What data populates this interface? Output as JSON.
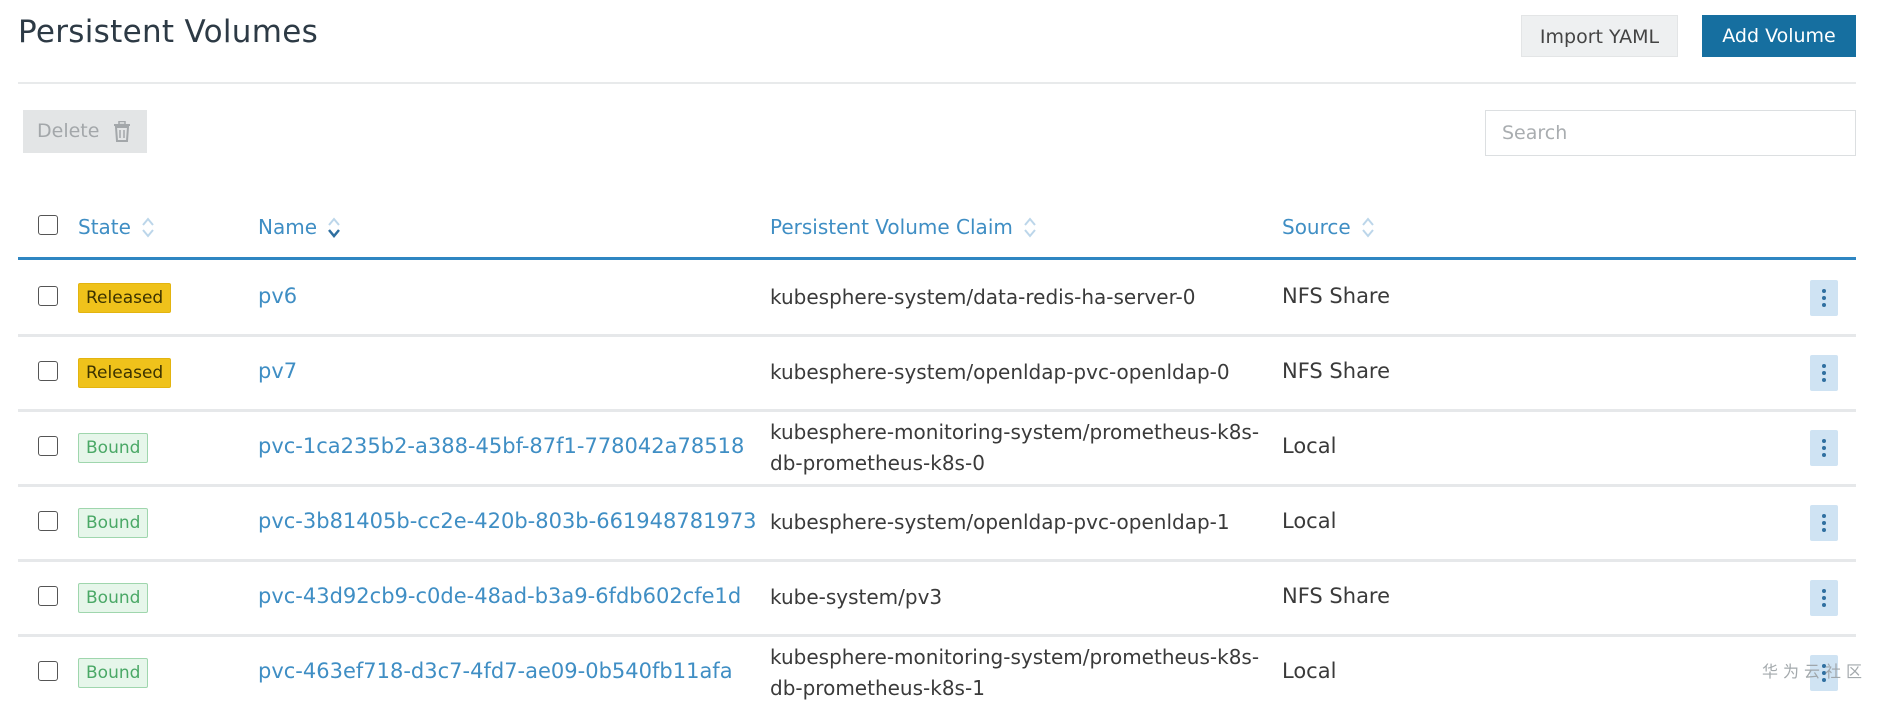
{
  "header": {
    "title": "Persistent Volumes",
    "import_label": "Import YAML",
    "add_label": "Add Volume"
  },
  "toolbar": {
    "delete_label": "Delete",
    "delete_icon": "trash-icon",
    "search_placeholder": "Search",
    "search_value": ""
  },
  "table": {
    "columns": [
      {
        "label": "State",
        "sort": "unsorted"
      },
      {
        "label": "Name",
        "sort": "descending"
      },
      {
        "label": "Persistent Volume Claim",
        "sort": "unsorted"
      },
      {
        "label": "Source",
        "sort": "unsorted"
      }
    ],
    "rows": [
      {
        "state": "Released",
        "name": "pv6",
        "pvc": "kubesphere-system/data-redis-ha-server-0",
        "source": "NFS Share"
      },
      {
        "state": "Released",
        "name": "pv7",
        "pvc": "kubesphere-system/openldap-pvc-openldap-0",
        "source": "NFS Share"
      },
      {
        "state": "Bound",
        "name": "pvc-1ca235b2-a388-45bf-87f1-778042a78518",
        "pvc": "kubesphere-monitoring-system/prometheus-k8s-db-prometheus-k8s-0",
        "source": "Local"
      },
      {
        "state": "Bound",
        "name": "pvc-3b81405b-cc2e-420b-803b-661948781973",
        "pvc": "kubesphere-system/openldap-pvc-openldap-1",
        "source": "Local"
      },
      {
        "state": "Bound",
        "name": "pvc-43d92cb9-c0de-48ad-b3a9-6fdb602cfe1d",
        "pvc": "kube-system/pv3",
        "source": "NFS Share"
      },
      {
        "state": "Bound",
        "name": "pvc-463ef718-d3c7-4fd7-ae09-0b540fb11afa",
        "pvc": "kubesphere-monitoring-system/prometheus-k8s-db-prometheus-k8s-1",
        "source": "Local"
      }
    ]
  },
  "watermark": "华为云社区",
  "colors": {
    "accent": "#166fa0",
    "link": "#3f8ec4",
    "released": "#efc21b",
    "bound": "#4aa866"
  }
}
